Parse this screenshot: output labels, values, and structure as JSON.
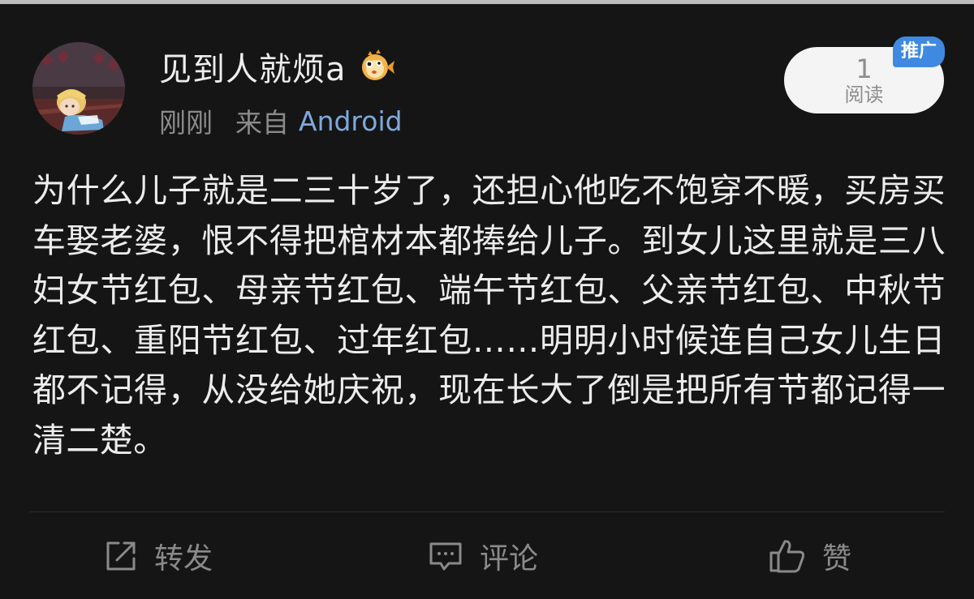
{
  "post": {
    "username": "见到人就烦a",
    "time": "刚刚",
    "from_label": "来自",
    "source": "Android",
    "read_count": "1",
    "read_label": "阅读",
    "promo_badge": "推广",
    "content": "为什么儿子就是二三十岁了，还担心他吃不饱穿不暖，买房买车娶老婆，恨不得把棺材本都捧给儿子。到女儿这里就是三八妇女节红包、母亲节红包、端午节红包、父亲节红包、中秋节红包、重阳节红包、过年红包……明明小时候连自己女儿生日都不记得，从没给她庆祝，现在长大了倒是把所有节都记得一清二楚。"
  },
  "actions": {
    "repost": "转发",
    "comment": "评论",
    "like": "赞"
  },
  "colors": {
    "background": "#151515",
    "text": "#ececec",
    "meta": "#8b8b8b",
    "source_link": "#7fa9de",
    "promo_badge": "#3f8ae0",
    "read_pill": "#f4f4f4"
  },
  "icons": {
    "avatar": "avatar-alice-illustration",
    "badge": "pufferfish-badge-icon",
    "repost": "repost-icon",
    "comment": "comment-icon",
    "like": "thumbs-up-icon"
  }
}
